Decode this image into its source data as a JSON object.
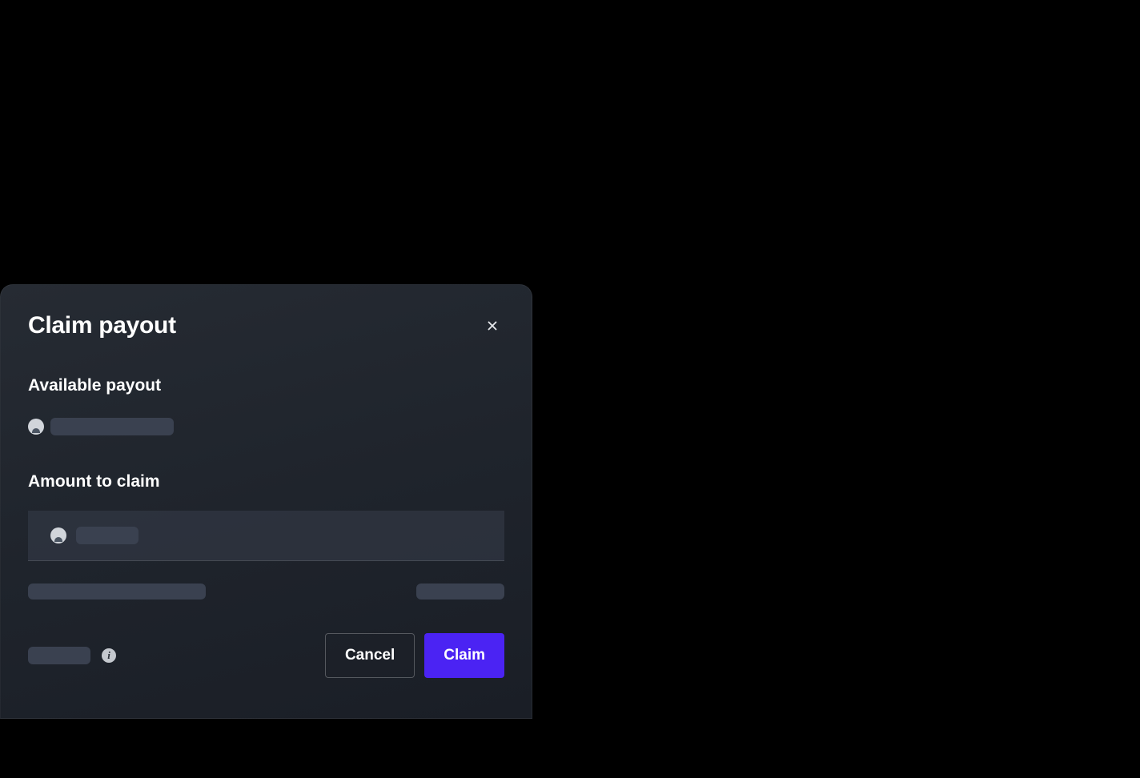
{
  "modal": {
    "title": "Claim payout",
    "sections": {
      "available_label": "Available payout",
      "amount_label": "Amount to claim"
    },
    "buttons": {
      "cancel": "Cancel",
      "claim": "Claim"
    },
    "icons": {
      "close": "close-icon",
      "token": "token-icon",
      "info": "info-icon"
    },
    "colors": {
      "primary": "#4B23F3",
      "background": "#1f242c",
      "skeleton": "#3a4150",
      "text": "#ffffff"
    }
  }
}
